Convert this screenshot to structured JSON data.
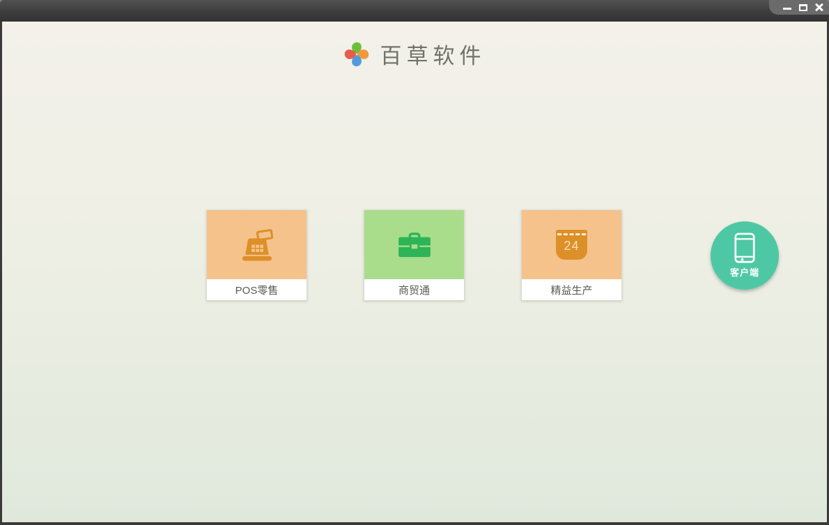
{
  "window": {
    "controls": {
      "minimize": "minimize",
      "maximize": "maximize",
      "close": "close"
    }
  },
  "header": {
    "app_name": "百草软件",
    "logo_petal_colors": [
      "#6CBF3B",
      "#F09A3D",
      "#4F9BDE",
      "#E65D4A"
    ]
  },
  "products": [
    {
      "label": "POS零售",
      "icon": "cash-register-icon",
      "card_color": "#F5C28C",
      "icon_color": "#DD9027"
    },
    {
      "label": "商贸通",
      "icon": "briefcase-icon",
      "card_color": "#A9DD8B",
      "icon_color": "#2DB457"
    },
    {
      "label": "精益生产",
      "icon": "calendar-icon",
      "calendar_day": "24",
      "card_color": "#F5C28C",
      "icon_color": "#DD9027"
    }
  ],
  "client_button": {
    "label": "客户端",
    "icon": "smartphone-icon",
    "color": "#4EC8A4"
  }
}
